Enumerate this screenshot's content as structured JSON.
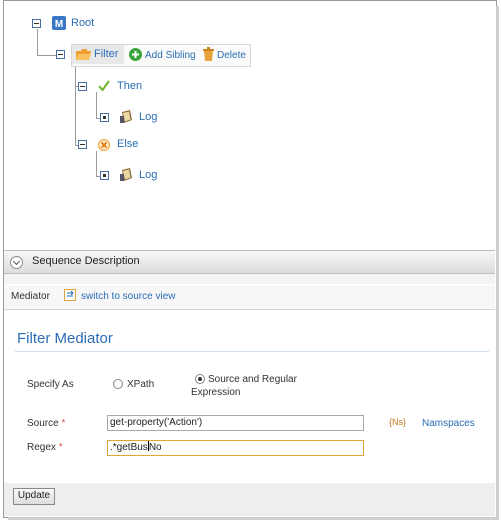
{
  "tree": {
    "root_label": "Root",
    "filter_label": "Filter",
    "add_sibling_label": "Add Sibling",
    "delete_label": "Delete",
    "then_label": "Then",
    "then_log_label": "Log",
    "else_label": "Else",
    "else_log_label": "Log"
  },
  "sequence_bar": {
    "label": "Sequence Description"
  },
  "mediator_bar": {
    "label": "Mediator",
    "switch_link": "switch to source view"
  },
  "form": {
    "title": "Filter Mediator",
    "specify_as_label": "Specify As",
    "option_xpath": "XPath",
    "option_source_regex_line1": "Source and Regular",
    "option_source_regex_line2": "Expression",
    "selected_option": "Source and Regular Expression",
    "source_label": "Source",
    "source_value": "get-property('Action')",
    "regex_label": "Regex",
    "regex_value_before_caret": ".*getBus",
    "regex_value_after_caret": "No",
    "required_marker": "*",
    "namespaces_icon_text": "{Ns}",
    "namespaces_link": "Namspaces",
    "update_button": "Update"
  },
  "colors": {
    "link": "#2a6db5",
    "required": "#d9534f",
    "focus_border": "#e0a43a"
  }
}
